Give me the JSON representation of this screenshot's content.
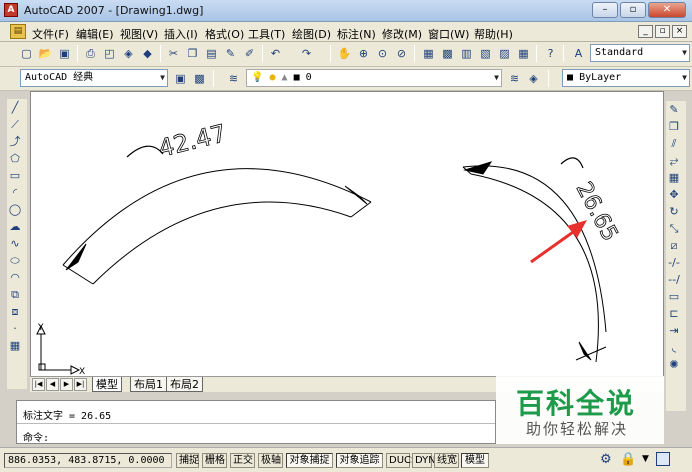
{
  "window": {
    "title": "AutoCAD 2007 - [Drawing1.dwg]",
    "app_icon": "autocad-logo-icon",
    "buttons": [
      "–",
      "▫",
      "✕"
    ]
  },
  "menubar": {
    "items": [
      "文件(F)",
      "编辑(E)",
      "视图(V)",
      "插入(I)",
      "格式(O)",
      "工具(T)",
      "绘图(D)",
      "标注(N)",
      "修改(M)",
      "窗口(W)",
      "帮助(H)"
    ],
    "mdi_buttons": [
      "_",
      "▫",
      "×"
    ]
  },
  "toolbar1": {
    "icons": [
      "new-file-icon",
      "open-folder-icon",
      "save-icon",
      "plot-icon",
      "plot-preview-icon",
      "publish-icon",
      "3d-dwf-icon",
      "cut-icon",
      "copy-icon",
      "paste-icon",
      "match-properties-icon",
      "block-editor-icon",
      "undo-icon",
      "redo-icon",
      "pan-icon",
      "zoom-realtime-icon",
      "zoom-window-icon",
      "zoom-previous-icon",
      "properties-icon",
      "design-center-icon",
      "tool-palettes-icon",
      "sheet-set-icon",
      "markup-icon",
      "quickcalc-icon",
      "help-icon",
      "text-style-icon"
    ],
    "text_style": "Standard"
  },
  "toolbar2": {
    "workspace": "AutoCAD 经典",
    "layer": "0",
    "color": "ByLayer"
  },
  "drawing": {
    "dim1_text": "42.47",
    "dim2_text": "26.65",
    "ucs_x": "X",
    "ucs_y": "Y"
  },
  "tabs": [
    "模型",
    "布局1",
    "布局2"
  ],
  "command": {
    "line1": "标注文字 = 26.65",
    "line2": "命令:"
  },
  "status": {
    "coords": "886.0353, 483.8715, 0.0000",
    "buttons": [
      "捕捉",
      "栅格",
      "正交",
      "极轴",
      "对象捕捉",
      "对象追踪",
      "DUCS",
      "DYN",
      "线宽",
      "模型"
    ]
  },
  "watermark": {
    "title": "百科全说",
    "subtitle": "助你轻松解决"
  },
  "colors": {
    "arrow": "#e8312e",
    "watermark": "#1d9a4a"
  }
}
